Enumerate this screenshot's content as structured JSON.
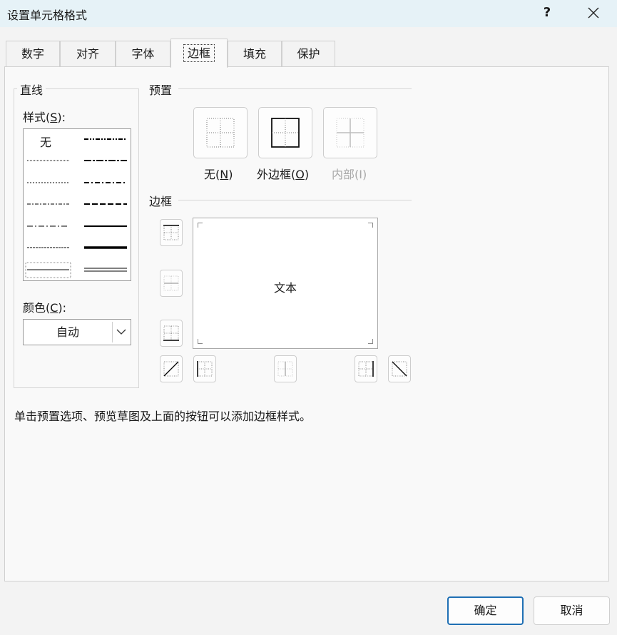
{
  "dialog": {
    "title": "设置单元格格式",
    "help_label": "?",
    "close_icon": "close-icon"
  },
  "tabs": [
    {
      "label": "数字",
      "active": false
    },
    {
      "label": "对齐",
      "active": false
    },
    {
      "label": "字体",
      "active": false
    },
    {
      "label": "边框",
      "active": true
    },
    {
      "label": "填充",
      "active": false
    },
    {
      "label": "保护",
      "active": false
    }
  ],
  "line": {
    "group_label": "直线",
    "style_label": "样式(",
    "style_mnemonic": "S",
    "style_suffix": "):",
    "none_label": "无",
    "color_label": "颜色(",
    "color_mnemonic": "C",
    "color_suffix": "):",
    "color_value": "自动",
    "line_color": "#000000"
  },
  "presets": {
    "group_label": "预置",
    "items": [
      {
        "label": "无(",
        "mnemonic": "N",
        "suffix": ")",
        "icon": "preset-none-icon",
        "disabled": false
      },
      {
        "label": "外边框(",
        "mnemonic": "O",
        "suffix": ")",
        "icon": "preset-outline-icon",
        "disabled": false
      },
      {
        "label": "内部(",
        "mnemonic": "I",
        "suffix": ")",
        "icon": "preset-inside-icon",
        "disabled": true
      }
    ]
  },
  "border": {
    "group_label": "边框",
    "preview_text": "文本"
  },
  "hint": "单击预置选项、预览草图及上面的按钮可以添加边框样式。",
  "buttons": {
    "ok": "确定",
    "cancel": "取消"
  },
  "colors": {
    "accent": "#1f6fb4",
    "titlebar": "#e6f2f7",
    "disabled_text": "#a8a8a8"
  }
}
